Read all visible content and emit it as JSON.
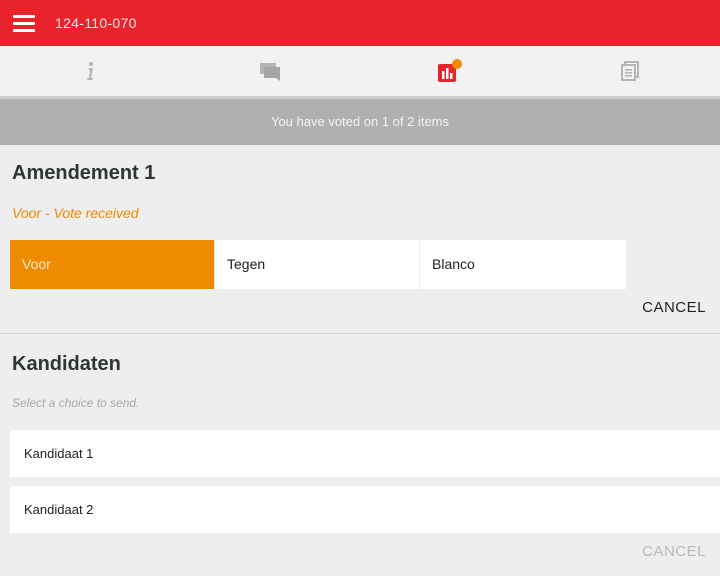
{
  "header": {
    "meeting_id": "124-110-070",
    "menu_icon": "hamburger-menu-icon",
    "bg_color": "#e8232b"
  },
  "tabs": [
    {
      "icon": "info-icon",
      "active": false
    },
    {
      "icon": "chat-icon",
      "active": false
    },
    {
      "icon": "vote-chart-icon",
      "active": true,
      "notification_badge": true
    },
    {
      "icon": "documents-icon",
      "active": false
    }
  ],
  "status": {
    "text": "You have voted on 1 of 2 items"
  },
  "items": [
    {
      "title": "Amendement 1",
      "vote_status": "Voor - Vote received",
      "choices": [
        "Voor",
        "Tegen",
        "Blanco"
      ],
      "selected": "Voor",
      "cancel_label": "CANCEL"
    },
    {
      "title": "Kandidaten",
      "hint": "Select a choice to send.",
      "options": [
        "Kandidaat 1",
        "Kandidaat 2"
      ],
      "cancel_label": "CANCEL"
    }
  ],
  "colors": {
    "accent": "#ee8b00",
    "status_bar": "#b0b0b0"
  }
}
